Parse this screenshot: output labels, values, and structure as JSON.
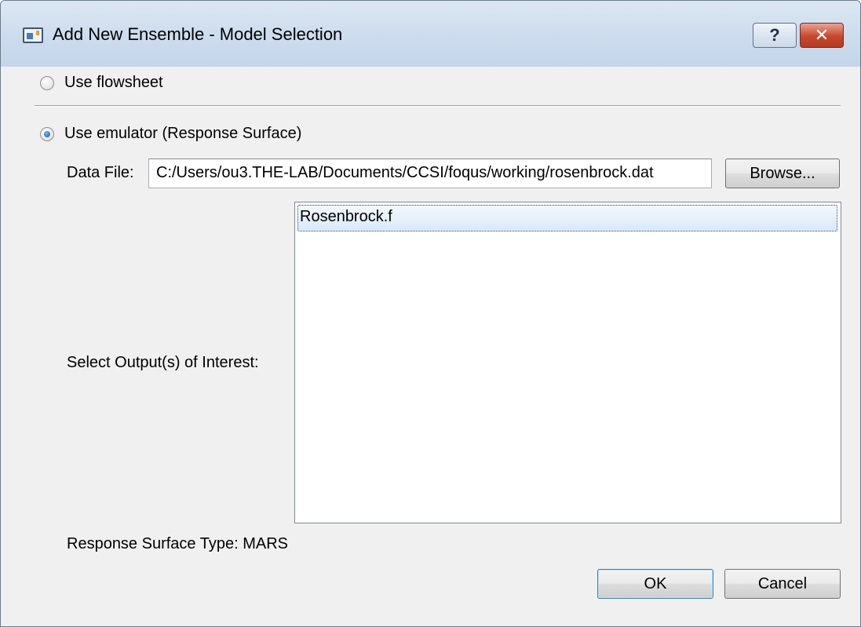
{
  "window": {
    "title": "Add New Ensemble - Model Selection",
    "help_glyph": "?",
    "close_glyph": "✕"
  },
  "options": {
    "flowsheet_label": "Use flowsheet",
    "flowsheet_selected": false,
    "emulator_label": "Use emulator (Response Surface)",
    "emulator_selected": true
  },
  "data_file": {
    "label": "Data File:",
    "value": "C:/Users/ou3.THE-LAB/Documents/CCSI/foqus/working/rosenbrock.dat",
    "browse_label": "Browse..."
  },
  "outputs": {
    "label": "Select Output(s) of Interest:",
    "items": [
      {
        "label": "Rosenbrock.f",
        "selected": true
      }
    ]
  },
  "response_surface": {
    "type_text": "Response Surface Type: MARS"
  },
  "footer": {
    "ok_label": "OK",
    "cancel_label": "Cancel"
  },
  "colors": {
    "titlebar": "#cfdeee",
    "dialog_background": "#f0f0f0",
    "close_button": "#c7472b",
    "selection_border": "#1e4f87"
  }
}
